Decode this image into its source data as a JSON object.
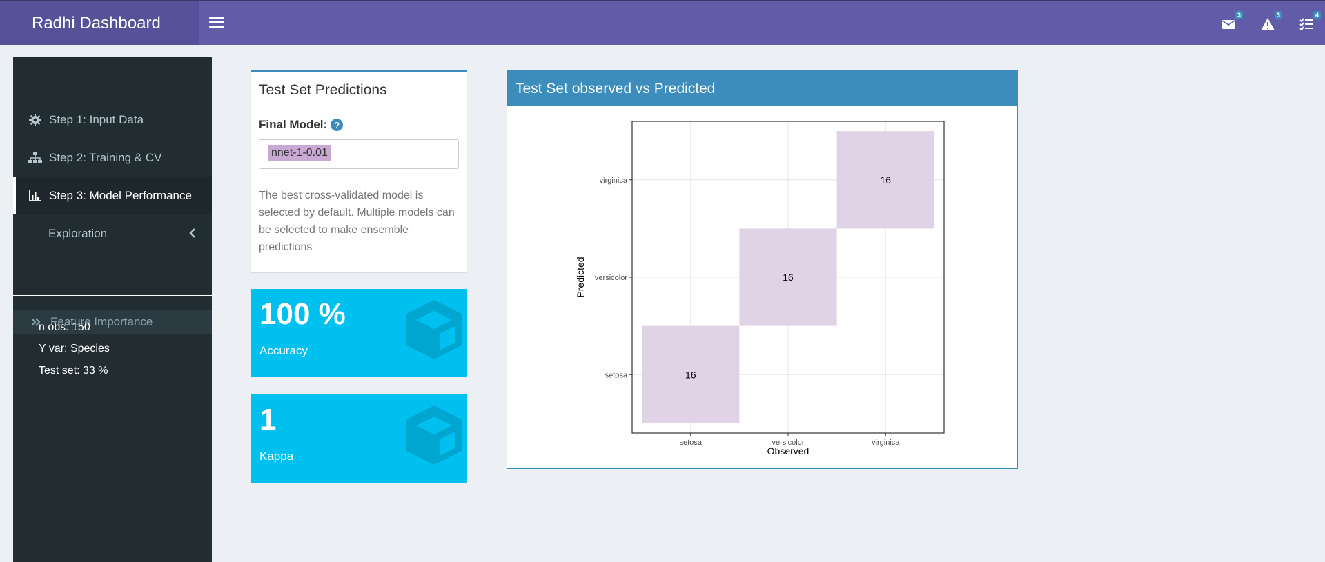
{
  "header": {
    "title": "Radhi Dashboard",
    "messages_count": "3",
    "alerts_count": "3",
    "tasks_count": "4"
  },
  "sidebar": {
    "items": [
      {
        "label": "Step 1: Input Data",
        "icon": "gear-icon"
      },
      {
        "label": "Step 2: Training & CV",
        "icon": "sitemap-icon"
      },
      {
        "label": "Step 3: Model Performance",
        "icon": "bar-chart-icon"
      },
      {
        "label": "Exploration",
        "icon": "chevron-left-icon"
      }
    ],
    "subitem": "Feature Importance",
    "info": {
      "n_obs": "n obs: 150",
      "y_var": "Y var: Species",
      "test_set": "Test set: 33 %"
    }
  },
  "predictions_box": {
    "title": "Test Set Predictions",
    "final_model_label": "Final Model:",
    "selected_model": "nnet-1-0.01",
    "description": "The best cross-validated model is selected by default. Multiple models can be selected to make ensemble predictions"
  },
  "accuracy": {
    "value": "100 %",
    "label": "Accuracy"
  },
  "kappa": {
    "value": "1",
    "label": "Kappa"
  },
  "plot_box": {
    "title": "Test Set observed vs Predicted"
  },
  "colors": {
    "header": "#605ca8",
    "brand": "#555299",
    "sidebar": "#222d32",
    "info_box": "#00c0ef",
    "primary": "#3c8dbc",
    "tile": "#e0d3e6"
  },
  "chart_data": {
    "type": "heatmap",
    "xlabel": "Observed",
    "ylabel": "Predicted",
    "x_categories": [
      "setosa",
      "versicolor",
      "virginica"
    ],
    "y_categories": [
      "setosa",
      "versicolor",
      "virginica"
    ],
    "cells": [
      {
        "observed": "setosa",
        "predicted": "setosa",
        "value": 16
      },
      {
        "observed": "versicolor",
        "predicted": "versicolor",
        "value": 16
      },
      {
        "observed": "virginica",
        "predicted": "virginica",
        "value": 16
      }
    ],
    "grid": true
  }
}
